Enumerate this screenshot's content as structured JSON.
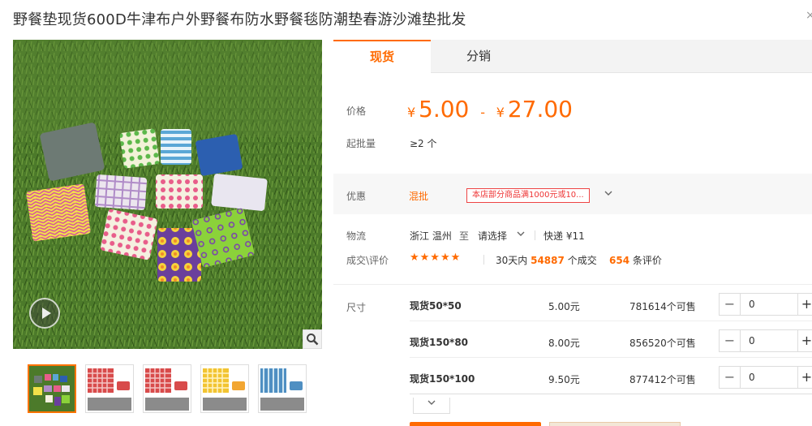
{
  "product": {
    "title": "野餐垫现货600D牛津布户外野餐布防水野餐毯防潮垫春游沙滩垫批发"
  },
  "tabs": [
    {
      "label": "现货",
      "active": true
    },
    {
      "label": "分销",
      "active": false
    }
  ],
  "price": {
    "label": "价格",
    "currency": "¥",
    "min": "5.00",
    "max": "27.00",
    "separator": "-"
  },
  "moq": {
    "label": "起批量",
    "value": "≥2 个"
  },
  "promotion": {
    "label": "优惠",
    "type": "混批",
    "tag": "本店部分商品满1000元或10..."
  },
  "shipping": {
    "label": "物流",
    "from": "浙江 温州",
    "to_separator": "至",
    "to": "请选择",
    "method": "快递 ¥11"
  },
  "deals": {
    "label": "成交\\评价",
    "rating_stars": 5,
    "stars_text": "★★★★★",
    "period": "30天内",
    "count": "54887",
    "count_suffix": "个成交",
    "reviews": "654",
    "reviews_suffix": "条评价"
  },
  "sizes": {
    "label": "尺寸",
    "rows": [
      {
        "name": "现货50*50",
        "price": "5.00元",
        "stock": "781614个可售",
        "qty": "0"
      },
      {
        "name": "现货150*80",
        "price": "8.00元",
        "stock": "856520个可售",
        "qty": "0"
      },
      {
        "name": "现货150*100",
        "price": "9.50元",
        "stock": "877412个可售",
        "qty": "0"
      }
    ]
  },
  "thumbnails": [
    {
      "name": "picnic-mats-group"
    },
    {
      "name": "red-plaid-mat"
    },
    {
      "name": "red-plaid-mat-2"
    },
    {
      "name": "yellow-plaid-mat"
    },
    {
      "name": "blue-stripe-mat"
    }
  ],
  "icons": {
    "close": "close-icon",
    "play": "play-icon",
    "zoom": "magnifier-icon",
    "chevron": "chevron-down-icon"
  },
  "colors": {
    "accent": "#ff6a00",
    "promo_border": "#e44444"
  }
}
